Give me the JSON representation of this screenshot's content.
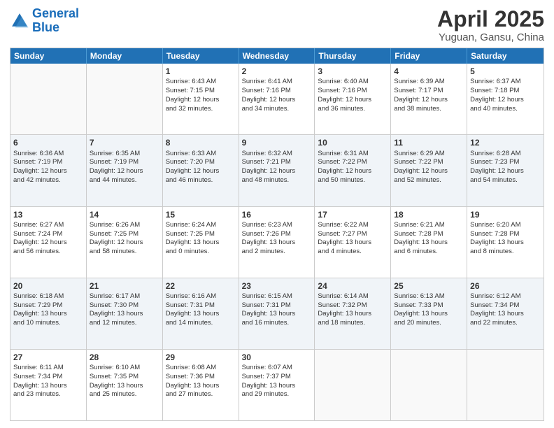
{
  "header": {
    "logo_general": "General",
    "logo_blue": "Blue",
    "main_title": "April 2025",
    "sub_title": "Yuguan, Gansu, China"
  },
  "day_headers": [
    "Sunday",
    "Monday",
    "Tuesday",
    "Wednesday",
    "Thursday",
    "Friday",
    "Saturday"
  ],
  "weeks": [
    [
      {
        "num": "",
        "text": ""
      },
      {
        "num": "",
        "text": ""
      },
      {
        "num": "1",
        "text": "Sunrise: 6:43 AM\nSunset: 7:15 PM\nDaylight: 12 hours\nand 32 minutes."
      },
      {
        "num": "2",
        "text": "Sunrise: 6:41 AM\nSunset: 7:16 PM\nDaylight: 12 hours\nand 34 minutes."
      },
      {
        "num": "3",
        "text": "Sunrise: 6:40 AM\nSunset: 7:16 PM\nDaylight: 12 hours\nand 36 minutes."
      },
      {
        "num": "4",
        "text": "Sunrise: 6:39 AM\nSunset: 7:17 PM\nDaylight: 12 hours\nand 38 minutes."
      },
      {
        "num": "5",
        "text": "Sunrise: 6:37 AM\nSunset: 7:18 PM\nDaylight: 12 hours\nand 40 minutes."
      }
    ],
    [
      {
        "num": "6",
        "text": "Sunrise: 6:36 AM\nSunset: 7:19 PM\nDaylight: 12 hours\nand 42 minutes."
      },
      {
        "num": "7",
        "text": "Sunrise: 6:35 AM\nSunset: 7:19 PM\nDaylight: 12 hours\nand 44 minutes."
      },
      {
        "num": "8",
        "text": "Sunrise: 6:33 AM\nSunset: 7:20 PM\nDaylight: 12 hours\nand 46 minutes."
      },
      {
        "num": "9",
        "text": "Sunrise: 6:32 AM\nSunset: 7:21 PM\nDaylight: 12 hours\nand 48 minutes."
      },
      {
        "num": "10",
        "text": "Sunrise: 6:31 AM\nSunset: 7:22 PM\nDaylight: 12 hours\nand 50 minutes."
      },
      {
        "num": "11",
        "text": "Sunrise: 6:29 AM\nSunset: 7:22 PM\nDaylight: 12 hours\nand 52 minutes."
      },
      {
        "num": "12",
        "text": "Sunrise: 6:28 AM\nSunset: 7:23 PM\nDaylight: 12 hours\nand 54 minutes."
      }
    ],
    [
      {
        "num": "13",
        "text": "Sunrise: 6:27 AM\nSunset: 7:24 PM\nDaylight: 12 hours\nand 56 minutes."
      },
      {
        "num": "14",
        "text": "Sunrise: 6:26 AM\nSunset: 7:25 PM\nDaylight: 12 hours\nand 58 minutes."
      },
      {
        "num": "15",
        "text": "Sunrise: 6:24 AM\nSunset: 7:25 PM\nDaylight: 13 hours\nand 0 minutes."
      },
      {
        "num": "16",
        "text": "Sunrise: 6:23 AM\nSunset: 7:26 PM\nDaylight: 13 hours\nand 2 minutes."
      },
      {
        "num": "17",
        "text": "Sunrise: 6:22 AM\nSunset: 7:27 PM\nDaylight: 13 hours\nand 4 minutes."
      },
      {
        "num": "18",
        "text": "Sunrise: 6:21 AM\nSunset: 7:28 PM\nDaylight: 13 hours\nand 6 minutes."
      },
      {
        "num": "19",
        "text": "Sunrise: 6:20 AM\nSunset: 7:28 PM\nDaylight: 13 hours\nand 8 minutes."
      }
    ],
    [
      {
        "num": "20",
        "text": "Sunrise: 6:18 AM\nSunset: 7:29 PM\nDaylight: 13 hours\nand 10 minutes."
      },
      {
        "num": "21",
        "text": "Sunrise: 6:17 AM\nSunset: 7:30 PM\nDaylight: 13 hours\nand 12 minutes."
      },
      {
        "num": "22",
        "text": "Sunrise: 6:16 AM\nSunset: 7:31 PM\nDaylight: 13 hours\nand 14 minutes."
      },
      {
        "num": "23",
        "text": "Sunrise: 6:15 AM\nSunset: 7:31 PM\nDaylight: 13 hours\nand 16 minutes."
      },
      {
        "num": "24",
        "text": "Sunrise: 6:14 AM\nSunset: 7:32 PM\nDaylight: 13 hours\nand 18 minutes."
      },
      {
        "num": "25",
        "text": "Sunrise: 6:13 AM\nSunset: 7:33 PM\nDaylight: 13 hours\nand 20 minutes."
      },
      {
        "num": "26",
        "text": "Sunrise: 6:12 AM\nSunset: 7:34 PM\nDaylight: 13 hours\nand 22 minutes."
      }
    ],
    [
      {
        "num": "27",
        "text": "Sunrise: 6:11 AM\nSunset: 7:34 PM\nDaylight: 13 hours\nand 23 minutes."
      },
      {
        "num": "28",
        "text": "Sunrise: 6:10 AM\nSunset: 7:35 PM\nDaylight: 13 hours\nand 25 minutes."
      },
      {
        "num": "29",
        "text": "Sunrise: 6:08 AM\nSunset: 7:36 PM\nDaylight: 13 hours\nand 27 minutes."
      },
      {
        "num": "30",
        "text": "Sunrise: 6:07 AM\nSunset: 7:37 PM\nDaylight: 13 hours\nand 29 minutes."
      },
      {
        "num": "",
        "text": ""
      },
      {
        "num": "",
        "text": ""
      },
      {
        "num": "",
        "text": ""
      }
    ]
  ]
}
